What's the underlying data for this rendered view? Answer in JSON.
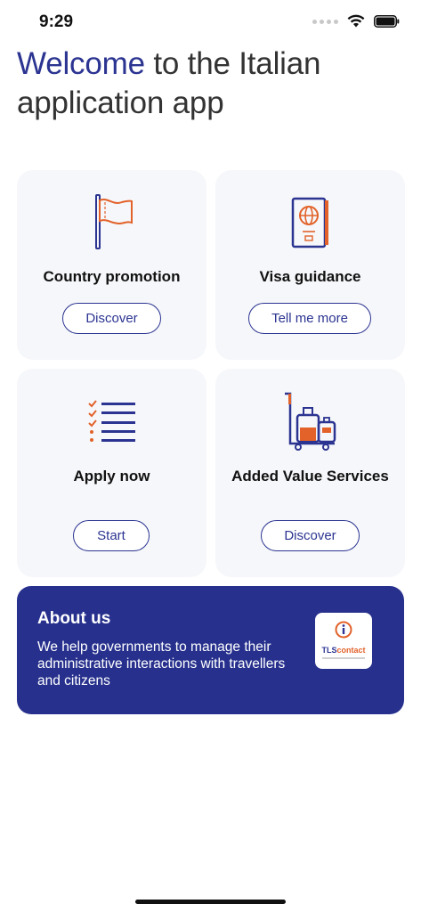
{
  "status": {
    "time": "9:29"
  },
  "header": {
    "title_accent": "Welcome",
    "title_rest": " to the Italian application app"
  },
  "cards": [
    {
      "title": "Country promotion",
      "button": "Discover",
      "icon": "flag-icon"
    },
    {
      "title": "Visa guidance",
      "button": "Tell me more",
      "icon": "passport-icon"
    },
    {
      "title": "Apply now",
      "button": "Start",
      "icon": "checklist-icon"
    },
    {
      "title": "Added Value Services",
      "button": "Discover",
      "icon": "luggage-cart-icon"
    }
  ],
  "about": {
    "title": "About us",
    "text": "We help governments to manage their administrative interactions with travellers and citizens",
    "logo_tls": "TLS",
    "logo_contact": "contact"
  },
  "colors": {
    "brand": "#2b3491",
    "accent": "#e2622a",
    "card_bg": "#f6f7fa"
  }
}
